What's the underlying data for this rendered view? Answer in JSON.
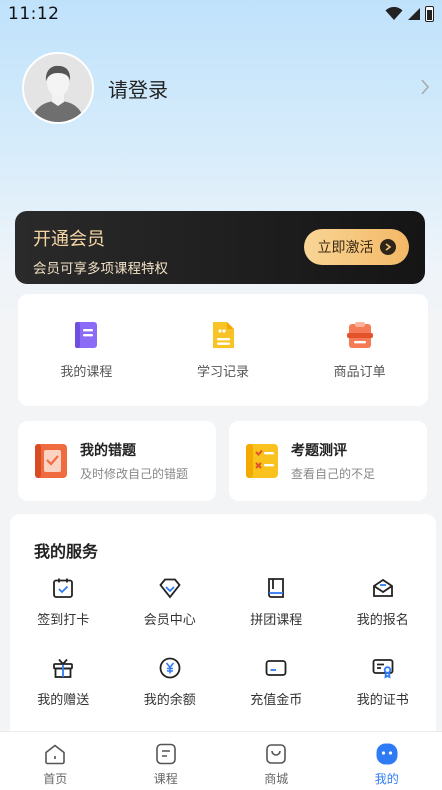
{
  "status_bar": {
    "time": "11:12"
  },
  "profile": {
    "login_label": "请登录"
  },
  "vip": {
    "title": "开通会员",
    "subtitle": "会员可享多项课程特权",
    "button_label": "立即激活"
  },
  "quick_links": [
    {
      "label": "我的课程",
      "icon": "course-book-icon"
    },
    {
      "label": "学习记录",
      "icon": "study-record-icon"
    },
    {
      "label": "商品订单",
      "icon": "order-icon"
    }
  ],
  "features": {
    "wrong": {
      "title": "我的错题",
      "subtitle": "及时修改自己的错题"
    },
    "exam": {
      "title": "考题测评",
      "subtitle": "查看自己的不足"
    }
  },
  "services": {
    "title": "我的服务",
    "items": [
      {
        "label": "签到打卡",
        "icon": "calendar-check-icon"
      },
      {
        "label": "会员中心",
        "icon": "diamond-icon"
      },
      {
        "label": "拼团课程",
        "icon": "book-icon"
      },
      {
        "label": "我的报名",
        "icon": "mail-icon"
      },
      {
        "label": "我的赠送",
        "icon": "gift-icon"
      },
      {
        "label": "我的余额",
        "icon": "yen-coin-icon"
      },
      {
        "label": "充值金币",
        "icon": "card-icon"
      },
      {
        "label": "我的证书",
        "icon": "certificate-icon"
      }
    ]
  },
  "tabbar": {
    "items": [
      {
        "label": "首页",
        "icon": "home-icon"
      },
      {
        "label": "课程",
        "icon": "course-icon"
      },
      {
        "label": "商城",
        "icon": "shop-bag-icon"
      },
      {
        "label": "我的",
        "icon": "profile-face-icon"
      }
    ],
    "active_index": 3
  },
  "colors": {
    "accent": "#2f7bf6",
    "vip_gold": "#f6d8a6",
    "vip_button": "#f5c57a",
    "course_purple": "#8b6cf6",
    "record_yellow": "#f7c325",
    "order_orange": "#f47b55",
    "wrong_orange": "#f06b3f",
    "exam_yellow": "#f9c21c"
  }
}
